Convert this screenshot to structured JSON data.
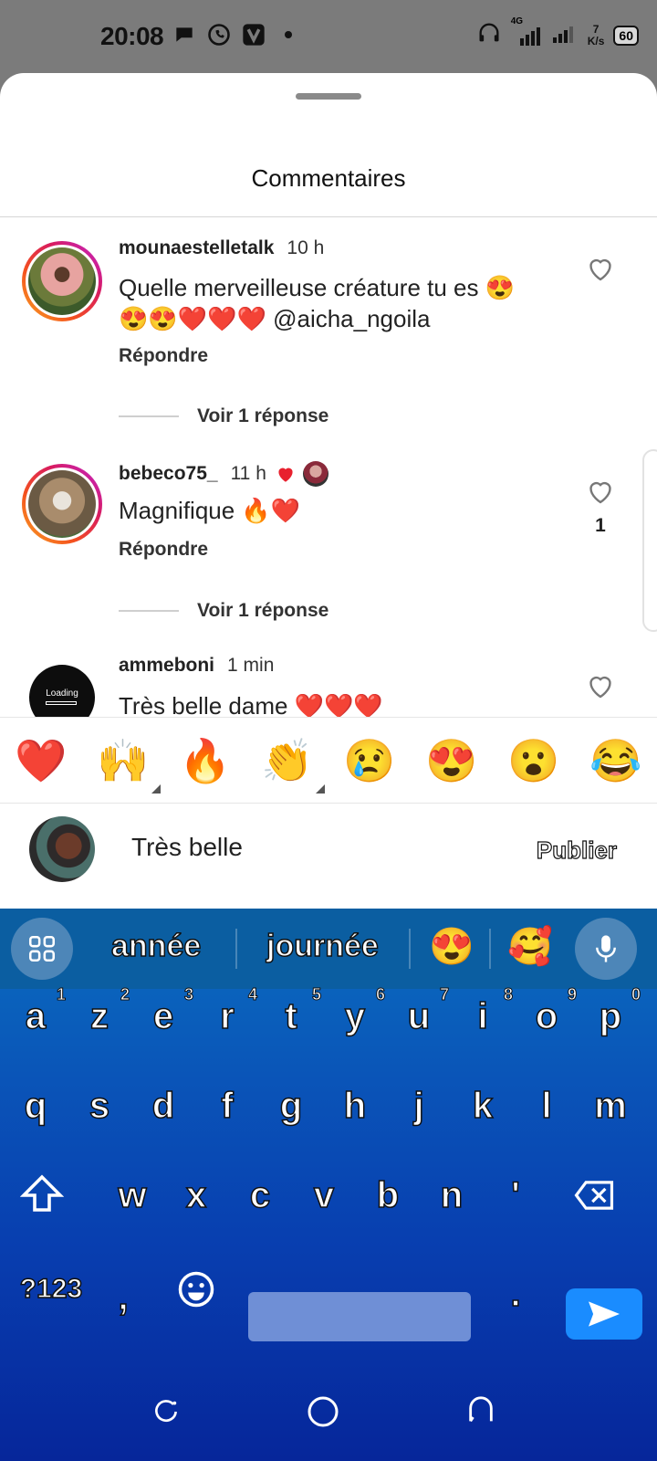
{
  "status_bar": {
    "time": "20:08",
    "network": "4G",
    "speed_value": "7",
    "speed_unit": "K/s",
    "battery": "60"
  },
  "sheet": {
    "title": "Commentaires"
  },
  "comments": [
    {
      "username": "mounaestelletalk",
      "time": "10 h",
      "text_line1": "Quelle merveilleuse créature tu es 😍",
      "text_line2": "😍😍❤️❤️❤️ @aicha_ngoila",
      "reply_label": "Répondre",
      "view_replies": "Voir 1 réponse"
    },
    {
      "username": "bebeco75_",
      "time": "11 h",
      "text": "Magnifique 🔥❤️",
      "reply_label": "Répondre",
      "view_replies": "Voir 1 réponse",
      "like_count": "1"
    },
    {
      "username": "ammeboni",
      "time": "1 min",
      "text": "Très belle dame ❤️❤️❤️",
      "avatar_label": "Loading"
    }
  ],
  "reactions": [
    "❤️",
    "🙌",
    "🔥",
    "👏",
    "😢",
    "😍",
    "😮",
    "😂"
  ],
  "composer": {
    "input_value": "Très belle",
    "publish_label": "Publier"
  },
  "keyboard": {
    "suggestions": [
      "année",
      "journée",
      "😍",
      "🥰"
    ],
    "row1": [
      "a",
      "z",
      "e",
      "r",
      "t",
      "y",
      "u",
      "i",
      "o",
      "p"
    ],
    "row1_numbers": [
      "1",
      "2",
      "3",
      "4",
      "5",
      "6",
      "7",
      "8",
      "9",
      "0"
    ],
    "row2": [
      "q",
      "s",
      "d",
      "f",
      "g",
      "h",
      "j",
      "k",
      "l",
      "m"
    ],
    "row3": [
      "w",
      "x",
      "c",
      "v",
      "b",
      "n",
      "'"
    ],
    "symbols_label": "?123",
    "comma": ",",
    "period": "."
  }
}
